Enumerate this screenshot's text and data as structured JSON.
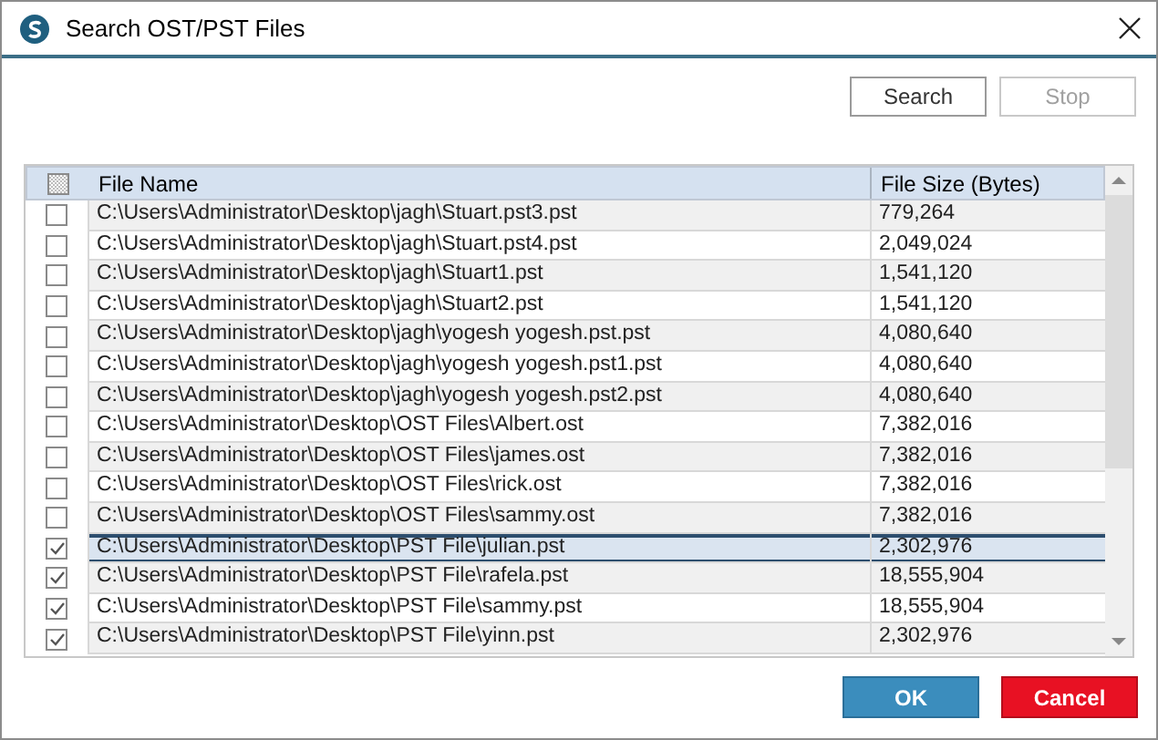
{
  "window": {
    "title": "Search OST/PST Files"
  },
  "toolbar": {
    "buttons": [
      {
        "label": "Search",
        "disabled": false
      },
      {
        "label": "Stop",
        "disabled": true
      }
    ]
  },
  "table": {
    "header_checkbox": {
      "indeterminate": true
    },
    "columns": [
      "File Name",
      "File Size (Bytes)"
    ],
    "rows": [
      {
        "name": "C:\\Users\\Administrator\\Desktop\\jagh\\Stuart.pst3.pst",
        "size": "779,264",
        "checked": false,
        "selected": false
      },
      {
        "name": "C:\\Users\\Administrator\\Desktop\\jagh\\Stuart.pst4.pst",
        "size": "2,049,024",
        "checked": false,
        "selected": false
      },
      {
        "name": "C:\\Users\\Administrator\\Desktop\\jagh\\Stuart1.pst",
        "size": "1,541,120",
        "checked": false,
        "selected": false
      },
      {
        "name": "C:\\Users\\Administrator\\Desktop\\jagh\\Stuart2.pst",
        "size": "1,541,120",
        "checked": false,
        "selected": false
      },
      {
        "name": "C:\\Users\\Administrator\\Desktop\\jagh\\yogesh yogesh.pst.pst",
        "size": "4,080,640",
        "checked": false,
        "selected": false
      },
      {
        "name": "C:\\Users\\Administrator\\Desktop\\jagh\\yogesh yogesh.pst1.pst",
        "size": "4,080,640",
        "checked": false,
        "selected": false
      },
      {
        "name": "C:\\Users\\Administrator\\Desktop\\jagh\\yogesh yogesh.pst2.pst",
        "size": "4,080,640",
        "checked": false,
        "selected": false
      },
      {
        "name": "C:\\Users\\Administrator\\Desktop\\OST Files\\Albert.ost",
        "size": "7,382,016",
        "checked": false,
        "selected": false
      },
      {
        "name": "C:\\Users\\Administrator\\Desktop\\OST Files\\james.ost",
        "size": "7,382,016",
        "checked": false,
        "selected": false
      },
      {
        "name": "C:\\Users\\Administrator\\Desktop\\OST Files\\rick.ost",
        "size": "7,382,016",
        "checked": false,
        "selected": false
      },
      {
        "name": "C:\\Users\\Administrator\\Desktop\\OST Files\\sammy.ost",
        "size": "7,382,016",
        "checked": false,
        "selected": false
      },
      {
        "name": "C:\\Users\\Administrator\\Desktop\\PST File\\julian.pst",
        "size": "2,302,976",
        "checked": true,
        "selected": true
      },
      {
        "name": "C:\\Users\\Administrator\\Desktop\\PST File\\rafela.pst",
        "size": "18,555,904",
        "checked": true,
        "selected": false
      },
      {
        "name": "C:\\Users\\Administrator\\Desktop\\PST File\\sammy.pst",
        "size": "18,555,904",
        "checked": true,
        "selected": false
      },
      {
        "name": "C:\\Users\\Administrator\\Desktop\\PST File\\yinn.pst",
        "size": "2,302,976",
        "checked": true,
        "selected": false
      }
    ]
  },
  "footer": {
    "buttons": [
      {
        "label": "OK",
        "kind": "primary"
      },
      {
        "label": "Cancel",
        "kind": "danger"
      }
    ]
  }
}
